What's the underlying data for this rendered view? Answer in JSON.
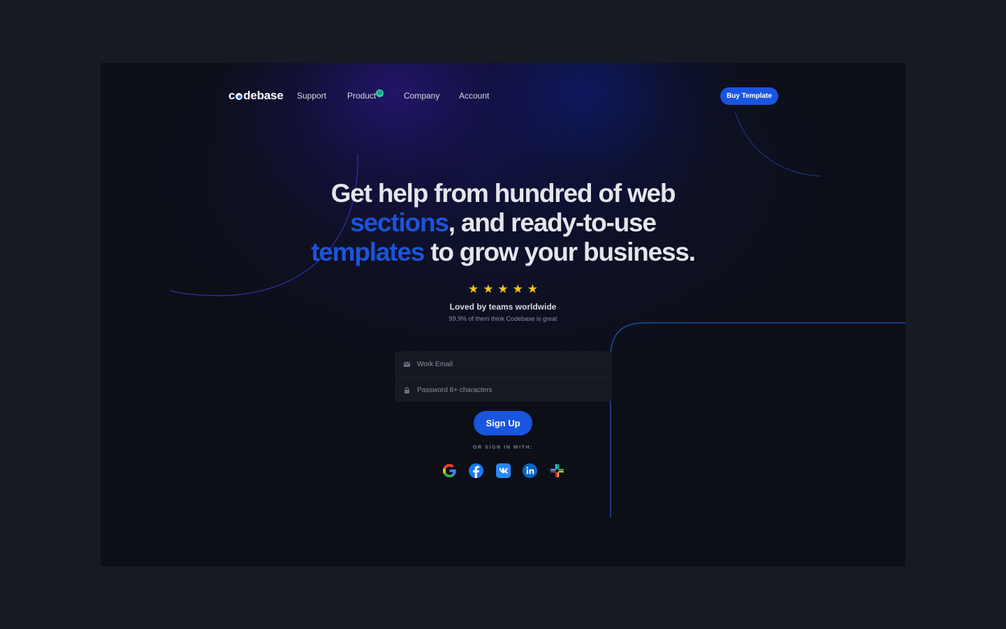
{
  "brand": {
    "logo_prefix": "c",
    "logo_suffix": "debase"
  },
  "nav": {
    "items": [
      "Support",
      "Product",
      "Company",
      "Account"
    ],
    "product_badge": "11",
    "cta": "Buy Template"
  },
  "hero": {
    "line1": "Get help from hundred of web",
    "line2_accent": "sections",
    "line2_rest": ", and ready-to-use",
    "line3_accent": "templates",
    "line3_rest": " to grow your business.",
    "rating_stars": 5,
    "loved": "Loved by teams worldwide",
    "loved_sub": "99.9% of them think Codebase is great"
  },
  "form": {
    "email_placeholder": "Work Email",
    "email_value": "",
    "password_placeholder": "Password 8+ characters",
    "password_value": "",
    "submit": "Sign Up",
    "or_label": "OR SIGN IN WITH:"
  },
  "social_icons": [
    "google-icon",
    "facebook-icon",
    "vk-icon",
    "linkedin-icon",
    "slack-icon"
  ],
  "colors": {
    "accent": "#1a55e0",
    "headline_accent": "#1c54d8",
    "page_bg": "#161a22",
    "frame_bg": "#0c0f16",
    "star": "#f5c518",
    "badge": "#2ad0a8"
  }
}
